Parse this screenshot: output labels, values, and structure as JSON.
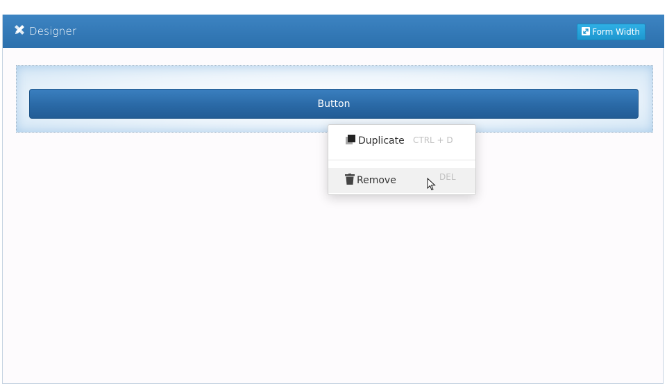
{
  "header": {
    "title": "Designer",
    "title_icon": "pencil-ruler-icon",
    "form_width_label": "Form Width",
    "form_width_icon": "expand-icon"
  },
  "canvas": {
    "button_label": "Button"
  },
  "context_menu": {
    "items": [
      {
        "label": "Duplicate",
        "shortcut": "CTRL + D",
        "icon": "copy-icon"
      },
      {
        "label": "Remove",
        "shortcut": "DEL",
        "icon": "trash-icon"
      }
    ]
  },
  "colors": {
    "header": "#3178b8",
    "form_width_button": "#27a4db",
    "form_button": "#2b6aa6",
    "panel_bg": "#fdfbfd"
  }
}
